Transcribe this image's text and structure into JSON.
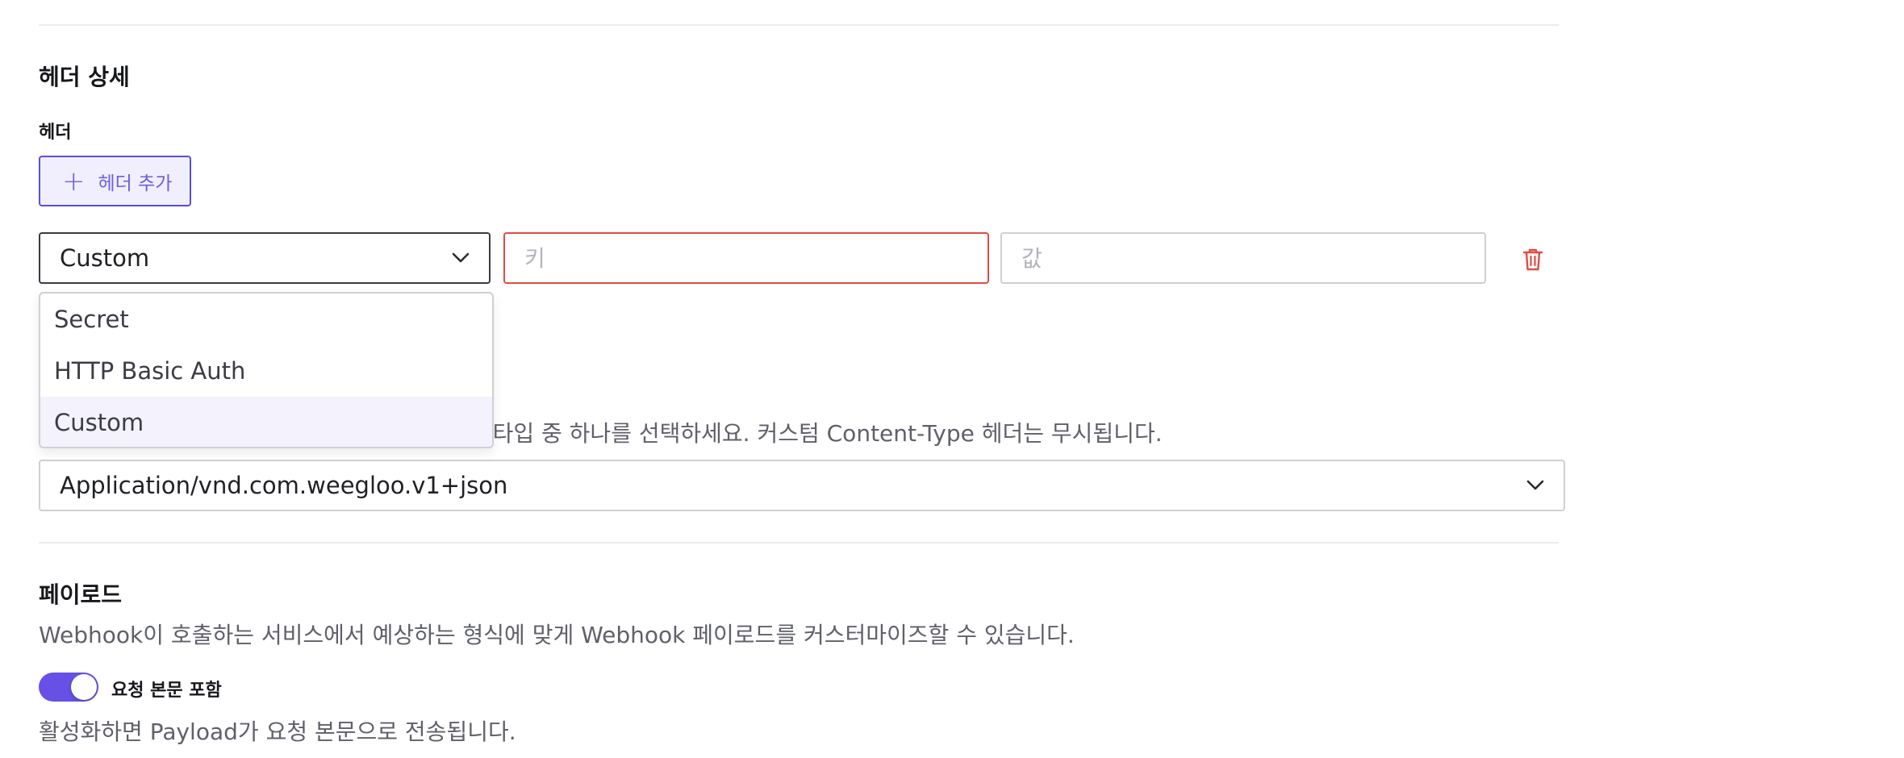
{
  "headers_section": {
    "title": "헤더 상세",
    "field_label": "헤더",
    "add_button_label": "헤더 추가",
    "row": {
      "type_selected": "Custom",
      "key_placeholder": "키",
      "value_placeholder": "값"
    },
    "type_options": [
      "Secret",
      "HTTP Basic Auth",
      "Custom"
    ],
    "type_options_selected_index": 2
  },
  "content_type": {
    "description_visible": "E 타입 중 하나를 선택하세요. 커스텀 Content-Type 헤더는 무시됩니다.",
    "selected": "Application/vnd.com.weegloo.v1+json"
  },
  "payload": {
    "title": "페이로드",
    "description": "Webhook이 호출하는 서비스에서 예상하는 형식에 맞게 Webhook 페이로드를 커스터마이즈할 수 있습니다.",
    "include_body_label": "요청 본문 포함",
    "include_body_enabled": true,
    "include_body_help": "활성화하면 Payload가 요청 본문으로 전송됩니다."
  },
  "colors": {
    "accent": "#6650e6",
    "error": "#e04b43",
    "border": "#cfcfd4"
  },
  "icons": {
    "add": "plus-icon",
    "dropdown": "chevron-down-icon",
    "delete": "trash-icon"
  }
}
